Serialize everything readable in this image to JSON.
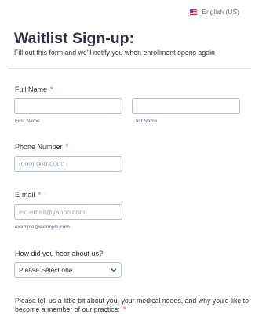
{
  "header": {
    "language": "English (US)"
  },
  "form": {
    "title": "Waitlist Sign-up:",
    "subtitle": "Fill out this form and we'll notify you when enrollment opens again",
    "required_marker": "*",
    "full_name": {
      "label": "Full Name",
      "first_sublabel": "First Name",
      "last_sublabel": "Last Name"
    },
    "phone": {
      "label": "Phone Number",
      "placeholder": "(000) 000-0000"
    },
    "email": {
      "label": "E-mail",
      "placeholder": "ex: email@yahoo.com",
      "sublabel": "example@example.com"
    },
    "hear_about": {
      "label": "How did you hear about us?",
      "selected": "Please Select one"
    },
    "about_you": {
      "label": "Please tell us a little bit about you, your medical needs, and why you'd like to become a member of our practice:"
    }
  }
}
